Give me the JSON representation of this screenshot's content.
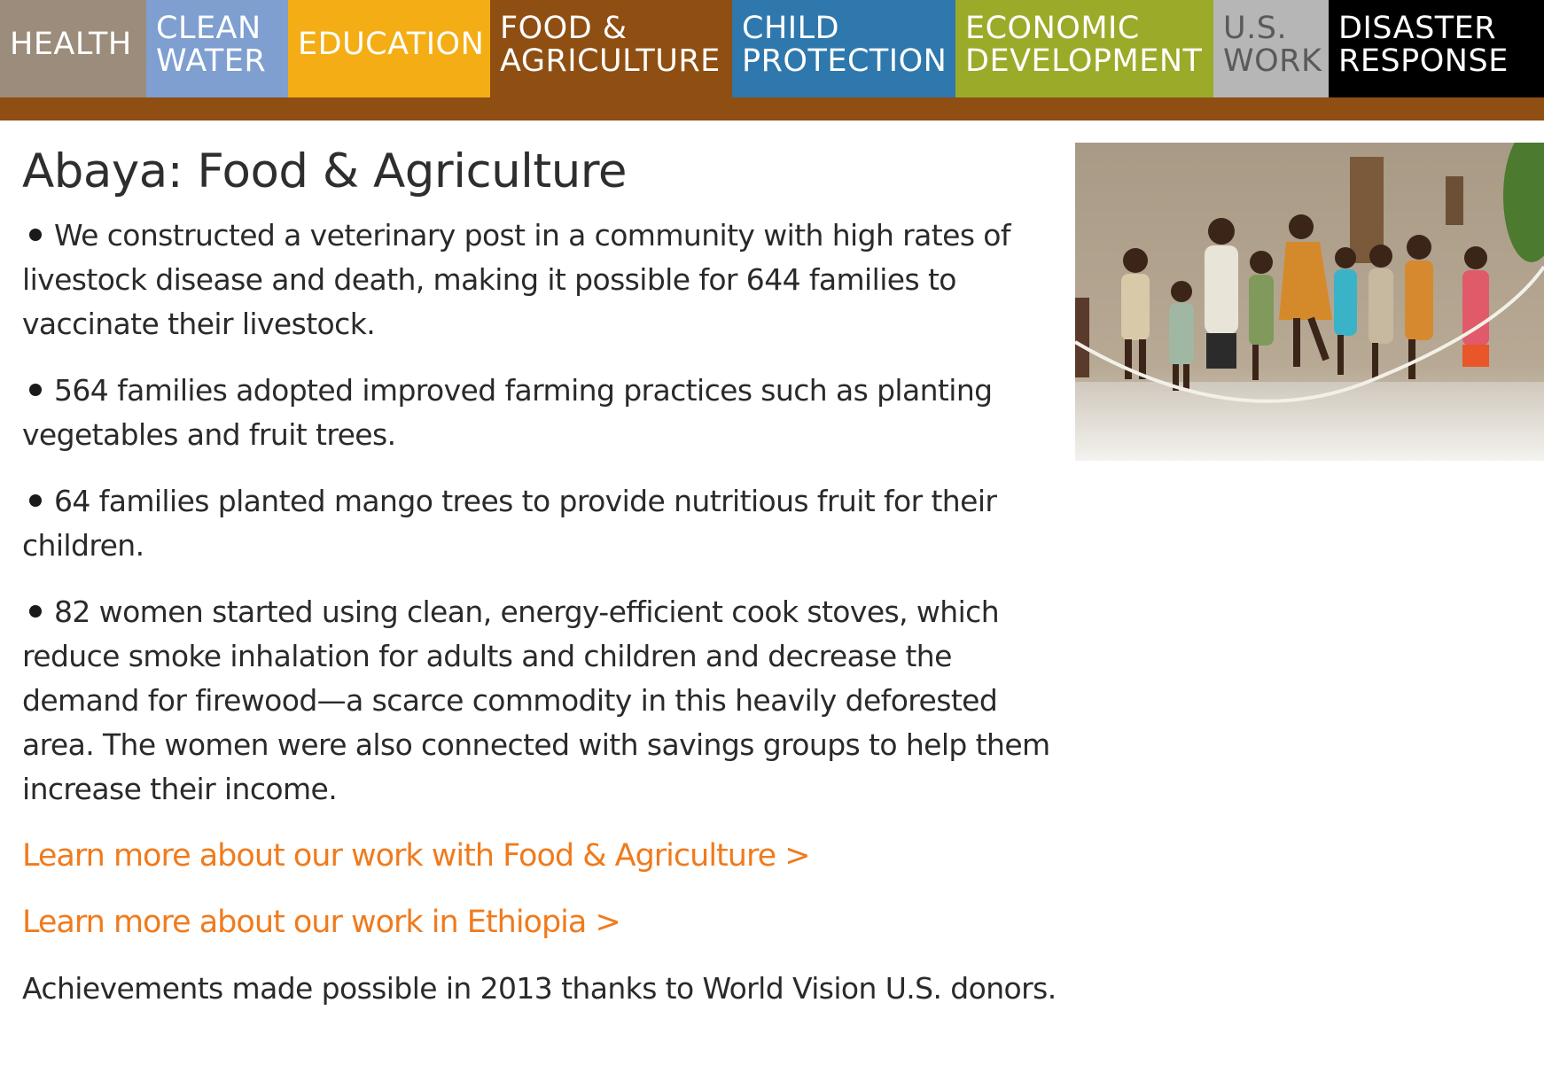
{
  "nav": {
    "tabs": [
      {
        "line1": "HEALTH",
        "line2": "",
        "color": "#9b8c7b"
      },
      {
        "line1": "CLEAN",
        "line2": "WATER",
        "color": "#7e9fd0"
      },
      {
        "line1": "EDUCATION",
        "line2": "",
        "color": "#f4ad14"
      },
      {
        "line1": "FOOD &",
        "line2": "AGRICULTURE",
        "color": "#8f4e12"
      },
      {
        "line1": "CHILD",
        "line2": "PROTECTION",
        "color": "#2f78ad"
      },
      {
        "line1": "ECONOMIC",
        "line2": "DEVELOPMENT",
        "color": "#9caa2a"
      },
      {
        "line1": "U.S.",
        "line2": "WORK",
        "color": "#b6b6b6"
      },
      {
        "line1": "DISASTER",
        "line2": "RESPONSE",
        "color": "#000000"
      }
    ],
    "active_bar_color": "#8f4e12"
  },
  "page": {
    "title": "Abaya: Food & Agriculture",
    "bullets": [
      "We constructed a veterinary post in a community with high rates of livestock disease and death, making it possible for 644 families to vaccinate their livestock.",
      "564 families adopted improved farming practices such as planting vegetables and fruit trees.",
      "64 families planted mango trees to provide nutritious fruit for their children.",
      "82 women started using clean, energy-efficient cook stoves, which reduce smoke inhalation for adults and children and decrease the demand for firewood—a scarce commodity in this heavily deforested area. The women were also connected with savings groups to help them increase their income."
    ],
    "links": {
      "food_agriculture": "Learn more about our work with Food & Agriculture >",
      "ethiopia": "Learn more about our work in Ethiopia >"
    },
    "footer_note": "Achievements made possible in 2013 thanks to World Vision U.S. donors."
  },
  "colors": {
    "link": "#f07b1d",
    "text": "#2a2a2a"
  }
}
